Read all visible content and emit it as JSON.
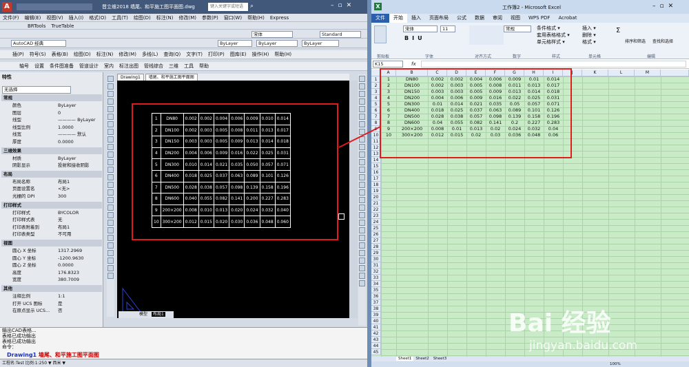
{
  "cad": {
    "title": "晋立维2018    墙尾、和平施工图平面图.dwg",
    "search_placeholder": "键入关键字或短语",
    "menu": [
      "文件(F)",
      "编辑(E)",
      "视图(V)",
      "插入(I)",
      "格式(O)",
      "工具(T)",
      "绘图(D)",
      "标注(N)",
      "修改(M)",
      "参数(P)",
      "窗口(W)",
      "帮助(H)",
      "Express"
    ],
    "plugins": [
      "BRTools",
      "TrueTable"
    ],
    "workspace": "AutoCAD 经典",
    "layer": "ByLayer",
    "font": "宋体",
    "style": "Standard",
    "menu2": [
      "插(P)",
      "符号(S)",
      "表格(B)",
      "绘图(D)",
      "标注(N)",
      "修改(M)",
      "多线(L)",
      "查询(Q)",
      "文字(T)",
      "打印(P)",
      "图库(E)",
      "操作(H)",
      "帮助(H)"
    ],
    "menu3": [
      "轴号",
      "设置",
      "条件图准备",
      "管道设计",
      "室内",
      "标注出图",
      "管线综合",
      "三维",
      "工具",
      "帮助"
    ],
    "props_title": "特性",
    "selection": "无选择",
    "sections": [
      {
        "title": "常规",
        "rows": [
          [
            "颜色",
            "ByLayer"
          ],
          [
            "图层",
            "0"
          ],
          [
            "线型",
            "———— ByLayer"
          ],
          [
            "线型比例",
            "1.0000"
          ],
          [
            "线宽",
            "———— 默认"
          ],
          [
            "厚度",
            "0.0000"
          ]
        ]
      },
      {
        "title": "三维效果",
        "rows": [
          [
            "材质",
            "ByLayer"
          ],
          [
            "阴影显示",
            "投射和接收阴影"
          ]
        ]
      },
      {
        "title": "布局",
        "rows": [
          [
            "布局名称",
            "布局1"
          ],
          [
            "页面设置名",
            "<无>"
          ],
          [
            "光栅的 DPI",
            "300"
          ]
        ]
      },
      {
        "title": "打印样式",
        "rows": [
          [
            "打印样式",
            "BYCOLOR"
          ],
          [
            "打印样式表",
            "无"
          ],
          [
            "打印表附着到",
            "布局1"
          ],
          [
            "打印表类型",
            "不可用"
          ]
        ]
      },
      {
        "title": "视图",
        "rows": [
          [
            "圆心 X 坐标",
            "1317.2969"
          ],
          [
            "圆心 Y 坐标",
            "-1200.9630"
          ],
          [
            "圆心 Z 坐标",
            "0.0000"
          ],
          [
            "高度",
            "176.8323"
          ],
          [
            "宽度",
            "380.7009"
          ]
        ]
      },
      {
        "title": "其他",
        "rows": [
          [
            "注释比例",
            "1:1"
          ],
          [
            "打开 UCS 图标",
            "是"
          ],
          [
            "在原点显示 UCS...",
            "否"
          ]
        ]
      }
    ],
    "doc_tabs": [
      "Drawing1",
      "墙尾、和平施工图平面图"
    ],
    "layout_tabs": [
      "模型",
      "布局1"
    ],
    "cmd_lines": [
      "输出CAD表格...",
      "表格已成功输出",
      "表格已成功输出",
      "命令："
    ],
    "cmd_tabs": [
      "Drawing1",
      "墙尾、和平施工图平面图"
    ],
    "status": "工程名:Test  比例:1:250 ▼ 西米 ▼",
    "table": [
      [
        "1",
        "DN80",
        "0.002",
        "0.002",
        "0.004",
        "0.006",
        "0.009",
        "0.010",
        "0.014"
      ],
      [
        "2",
        "DN100",
        "0.002",
        "0.003",
        "0.005",
        "0.008",
        "0.011",
        "0.013",
        "0.017"
      ],
      [
        "3",
        "DN150",
        "0.003",
        "0.003",
        "0.005",
        "0.009",
        "0.013",
        "0.014",
        "0.018"
      ],
      [
        "4",
        "DN200",
        "0.004",
        "0.006",
        "0.009",
        "0.016",
        "0.022",
        "0.025",
        "0.031"
      ],
      [
        "5",
        "DN300",
        "0.010",
        "0.014",
        "0.021",
        "0.035",
        "0.050",
        "0.057",
        "0.071"
      ],
      [
        "6",
        "DN400",
        "0.018",
        "0.025",
        "0.037",
        "0.063",
        "0.089",
        "0.101",
        "0.126"
      ],
      [
        "7",
        "DN500",
        "0.028",
        "0.038",
        "0.057",
        "0.098",
        "0.139",
        "0.158",
        "0.196"
      ],
      [
        "8",
        "DN600",
        "0.040",
        "0.055",
        "0.082",
        "0.141",
        "0.200",
        "0.227",
        "0.283"
      ],
      [
        "9",
        "200×200",
        "0.008",
        "0.010",
        "0.013",
        "0.020",
        "0.024",
        "0.032",
        "0.040"
      ],
      [
        "10",
        "300×200",
        "0.012",
        "0.015",
        "0.020",
        "0.030",
        "0.036",
        "0.048",
        "0.060"
      ]
    ]
  },
  "excel": {
    "title": "工作簿2 - Microsoft Excel",
    "tabs": [
      "文件",
      "开始",
      "插入",
      "页面布局",
      "公式",
      "数据",
      "审阅",
      "视图",
      "WPS PDF",
      "Acrobat"
    ],
    "font": "宋体",
    "size": "11",
    "number_format": "常规",
    "styles": [
      "条件格式 ▾",
      "套用表格格式 ▾",
      "单元格样式 ▾"
    ],
    "cells_ops": [
      "插入 ▾",
      "删除 ▾",
      "格式 ▾"
    ],
    "editing": [
      "排序和筛选",
      "查找和选择"
    ],
    "groups": [
      "剪贴板",
      "字体",
      "对齐方式",
      "数字",
      "样式",
      "单元格",
      "编辑"
    ],
    "name_box": "K15",
    "fx": "fx",
    "columns": [
      "A",
      "B",
      "C",
      "D",
      "E",
      "F",
      "G",
      "H",
      "I",
      "J",
      "K",
      "L",
      "M"
    ],
    "rows": [
      "1",
      "2",
      "3",
      "4",
      "5",
      "6",
      "7",
      "8",
      "9",
      "10",
      "11",
      "12",
      "13",
      "14",
      "15",
      "16",
      "17",
      "18",
      "19",
      "20",
      "21",
      "22",
      "23",
      "24",
      "25",
      "26",
      "27",
      "28",
      "29",
      "30",
      "31",
      "32",
      "33",
      "34",
      "35",
      "36",
      "37",
      "38",
      "39",
      "40",
      "41",
      "42",
      "43",
      "44",
      "45"
    ],
    "data": [
      [
        "1",
        "DN80",
        "0.002",
        "0.002",
        "0.004",
        "0.006",
        "0.009",
        "0.01",
        "0.014"
      ],
      [
        "2",
        "DN100",
        "0.002",
        "0.003",
        "0.005",
        "0.008",
        "0.011",
        "0.013",
        "0.017"
      ],
      [
        "3",
        "DN150",
        "0.003",
        "0.003",
        "0.005",
        "0.009",
        "0.013",
        "0.014",
        "0.018"
      ],
      [
        "4",
        "DN200",
        "0.004",
        "0.006",
        "0.009",
        "0.016",
        "0.022",
        "0.025",
        "0.031"
      ],
      [
        "5",
        "DN300",
        "0.01",
        "0.014",
        "0.021",
        "0.035",
        "0.05",
        "0.057",
        "0.071"
      ],
      [
        "6",
        "DN400",
        "0.018",
        "0.025",
        "0.037",
        "0.063",
        "0.089",
        "0.101",
        "0.126"
      ],
      [
        "7",
        "DN500",
        "0.028",
        "0.038",
        "0.057",
        "0.098",
        "0.139",
        "0.158",
        "0.196"
      ],
      [
        "8",
        "DN600",
        "0.04",
        "0.055",
        "0.082",
        "0.141",
        "0.2",
        "0.227",
        "0.283"
      ],
      [
        "9",
        "200×200",
        "0.008",
        "0.01",
        "0.013",
        "0.02",
        "0.024",
        "0.032",
        "0.04"
      ],
      [
        "10",
        "300×200",
        "0.012",
        "0.015",
        "0.02",
        "0.03",
        "0.036",
        "0.048",
        "0.06"
      ]
    ],
    "sheets": [
      "Sheet1",
      "Sheet2",
      "Sheet3"
    ],
    "zoom": "100%"
  },
  "watermark": {
    "brand": "Bai 经验",
    "url": "jingyan.baidu.com"
  }
}
